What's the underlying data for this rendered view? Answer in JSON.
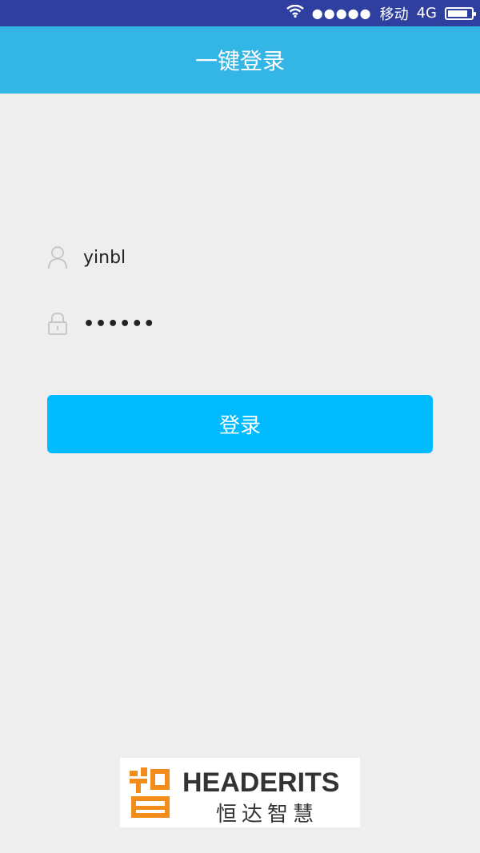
{
  "status_bar": {
    "carrier": "移动",
    "network": "4G",
    "signal_dots": "●●●●●",
    "battery_level": 0.85
  },
  "header": {
    "title": "一键登录"
  },
  "form": {
    "username_value": "yinbl",
    "password_value": "••••••"
  },
  "login_button": {
    "label": "登录"
  },
  "logo": {
    "en": "HEADERITS",
    "cn": "恒达智慧"
  },
  "colors": {
    "status_bar": "#2f3f9f",
    "header": "#33b5e5",
    "button": "#00bbff",
    "background": "#eeeeee",
    "logo_orange": "#f28c1a"
  },
  "icons": {
    "wifi": "wifi-icon",
    "user": "user-icon",
    "lock": "lock-icon",
    "battery": "battery-icon"
  }
}
